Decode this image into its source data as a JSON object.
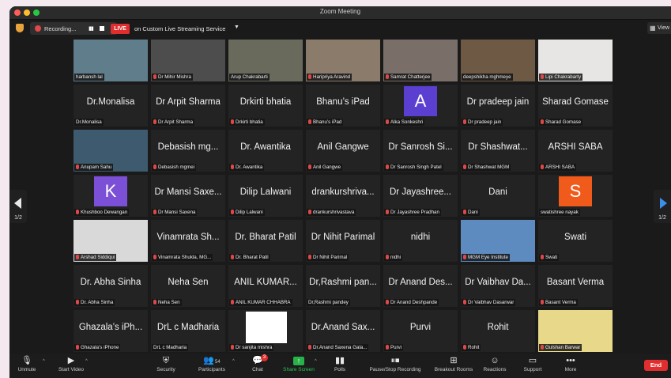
{
  "window": {
    "title": "Zoom Meeting"
  },
  "status": {
    "recording_label": "Recording...",
    "live_label": "LIVE",
    "stream_label": "on Custom Live Streaming Service",
    "view_label": "View"
  },
  "pagination": {
    "left": "1/2",
    "right": "1/2"
  },
  "colors": {
    "active_speaker": "#b7e06a",
    "live_red": "#e02e2e",
    "share_green": "#27b34a"
  },
  "tiles": [
    {
      "kind": "video",
      "big": "",
      "label": "harbansh lal",
      "muted": false,
      "bg": "#5f7d8a",
      "active": true
    },
    {
      "kind": "video",
      "big": "",
      "label": "Dr Mihir Mishra",
      "muted": true,
      "bg": "#4d4d4d"
    },
    {
      "kind": "video",
      "big": "",
      "label": "Arup Chakrabarti",
      "muted": false,
      "bg": "#6a6a5c"
    },
    {
      "kind": "video",
      "big": "",
      "label": "Haripriya Aravind",
      "muted": true,
      "bg": "#8a7b6b"
    },
    {
      "kind": "video",
      "big": "",
      "label": "Samrat Chatterjee",
      "muted": true,
      "bg": "#7a6f68"
    },
    {
      "kind": "video",
      "big": "",
      "label": "deepshikha mghmeye",
      "muted": false,
      "bg": "#6e5a44"
    },
    {
      "kind": "video",
      "big": "",
      "label": "Lipi Chakrabarty",
      "muted": true,
      "bg": "#e8e6e4"
    },
    {
      "kind": "name",
      "big": "Dr.Monalisa",
      "label": "Dr.Monalisa",
      "muted": false
    },
    {
      "kind": "name",
      "big": "Dr Arpit Sharma",
      "label": "Dr Arpit Sharma",
      "muted": true
    },
    {
      "kind": "name",
      "big": "Drkirti bhatia",
      "label": "Drkirti bhatia",
      "muted": true
    },
    {
      "kind": "name",
      "big": "Bhanu’s iPad",
      "label": "Bhanu’s iPad",
      "muted": true
    },
    {
      "kind": "avatar",
      "big": "A",
      "label": "Alka Sonkeshri",
      "muted": true,
      "bg": "#5b3fd0"
    },
    {
      "kind": "name",
      "big": "Dr pradeep jain",
      "label": "Dr pradeep jain",
      "muted": true
    },
    {
      "kind": "name",
      "big": "Sharad Gomase",
      "label": "Sharad Gomase",
      "muted": true
    },
    {
      "kind": "video",
      "big": "",
      "label": "Anupam Sahu",
      "muted": true,
      "bg": "#3e5a6e"
    },
    {
      "kind": "name",
      "big": "Debasish mg...",
      "label": "Debasish mgmei",
      "muted": true
    },
    {
      "kind": "name",
      "big": "Dr. Awantika",
      "label": "Dr. Awantika",
      "muted": true
    },
    {
      "kind": "name",
      "big": "Anil Gangwe",
      "label": "Anil Gangwe",
      "muted": true
    },
    {
      "kind": "name",
      "big": "Dr Sanrosh Si...",
      "label": "Dr Sanrosh Singh Patel",
      "muted": true
    },
    {
      "kind": "name",
      "big": "Dr Shashwat...",
      "label": "Dr Shashwat MGM",
      "muted": true
    },
    {
      "kind": "name",
      "big": "ARSHI SABA",
      "label": "ARSHI SABA",
      "muted": true
    },
    {
      "kind": "avatar",
      "big": "K",
      "label": "Khushboo Dewangan",
      "muted": true,
      "bg": "#7b4fd6"
    },
    {
      "kind": "name",
      "big": "Dr Mansi Saxe...",
      "label": "Dr Mansi Saxena",
      "muted": true
    },
    {
      "kind": "name",
      "big": "Dilip Lalwani",
      "label": "Dilip Lalwani",
      "muted": true
    },
    {
      "kind": "name",
      "big": "drankurshriva...",
      "label": "drankurshrivastava",
      "muted": true
    },
    {
      "kind": "name",
      "big": "Dr Jayashree...",
      "label": "Dr Jayashree Pradhan",
      "muted": true
    },
    {
      "kind": "name",
      "big": "Dani",
      "label": "Dani",
      "muted": true
    },
    {
      "kind": "avatar",
      "big": "S",
      "label": "swatishree nayak",
      "muted": false,
      "bg": "#f05a1a"
    },
    {
      "kind": "video",
      "big": "",
      "label": "Arshad Siddiqui",
      "muted": true,
      "bg": "#d9d9d9"
    },
    {
      "kind": "name",
      "big": "Vinamrata Sh...",
      "label": "Vinamrata Shukla, MG...",
      "muted": true
    },
    {
      "kind": "name",
      "big": "Dr. Bharat Patil",
      "label": "Dr. Bharat Patil",
      "muted": true
    },
    {
      "kind": "name",
      "big": "Dr Nihit Parimal",
      "label": "Dr Nihit Parimal",
      "muted": true
    },
    {
      "kind": "name",
      "big": "nidhi",
      "label": "nidhi",
      "muted": true
    },
    {
      "kind": "video",
      "big": "",
      "label": "MGM Eye Institute",
      "muted": true,
      "bg": "#5d8bc0"
    },
    {
      "kind": "name",
      "big": "Swati",
      "label": "Swati",
      "muted": true
    },
    {
      "kind": "name",
      "big": "Dr. Abha Sinha",
      "label": "Dr. Abha Sinha",
      "muted": true
    },
    {
      "kind": "name",
      "big": "Neha Sen",
      "label": "Neha Sen",
      "muted": true
    },
    {
      "kind": "name",
      "big": "ANIL KUMAR...",
      "label": "ANIL KUMAR CHHABRA",
      "muted": true
    },
    {
      "kind": "name",
      "big": "Dr,Rashmi pan...",
      "label": "Dr,Rashmi pandey",
      "muted": false
    },
    {
      "kind": "name",
      "big": "Dr Anand Des...",
      "label": "Dr Anand Deshpande",
      "muted": true
    },
    {
      "kind": "name",
      "big": "Dr Vaibhav Da...",
      "label": "Dr Vaibhav Dasarwar",
      "muted": true
    },
    {
      "kind": "name",
      "big": "Basant Verma",
      "label": "Basant Verma",
      "muted": true
    },
    {
      "kind": "name",
      "big": "Ghazala’s iPh...",
      "label": "Ghazala’s iPhone",
      "muted": true
    },
    {
      "kind": "name",
      "big": "DrL c Madharia",
      "label": "DrL c Madharia",
      "muted": false
    },
    {
      "kind": "blank",
      "big": "",
      "label": "Dr sanjita mishra",
      "muted": true,
      "bg": "#ffffff"
    },
    {
      "kind": "name",
      "big": "Dr.Anand Sax...",
      "label": "Dr.Anand Saxena Gala...",
      "muted": true
    },
    {
      "kind": "name",
      "big": "Purvi",
      "label": "Purvi",
      "muted": true
    },
    {
      "kind": "name",
      "big": "Rohit",
      "label": "Rohit",
      "muted": true
    },
    {
      "kind": "video",
      "big": "",
      "label": "Gulshan Barwar",
      "muted": true,
      "bg": "#e8d98a"
    }
  ],
  "toolbar": {
    "unmute": "Unmute",
    "start_video": "Start Video",
    "security": "Security",
    "participants": "Participants",
    "participants_count": "54",
    "chat": "Chat",
    "chat_badge": "3",
    "share_screen": "Share Screen",
    "polls": "Polls",
    "pause_stop_recording": "Pause/Stop Recording",
    "breakout_rooms": "Breakout Rooms",
    "reactions": "Reactions",
    "support": "Support",
    "more": "More",
    "end": "End"
  }
}
